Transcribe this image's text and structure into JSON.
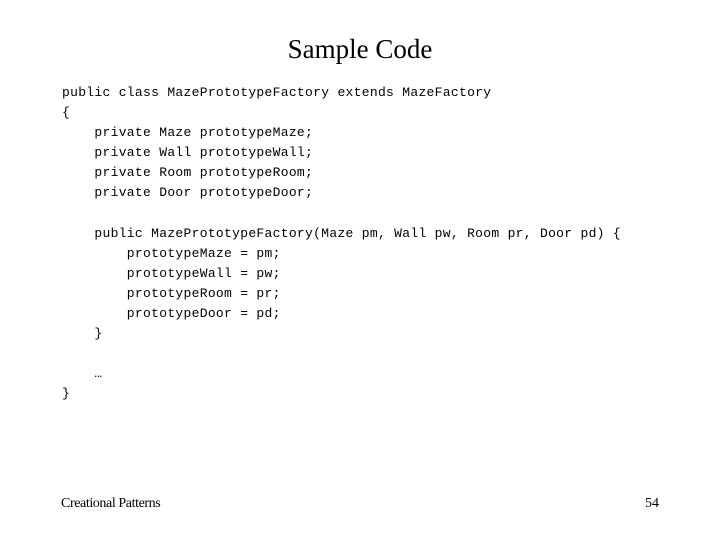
{
  "slide": {
    "title": "Sample Code",
    "code_lines": [
      "public class MazePrototypeFactory extends MazeFactory",
      "{",
      "    private Maze prototypeMaze;",
      "    private Wall prototypeWall;",
      "    private Room prototypeRoom;",
      "    private Door prototypeDoor;",
      "",
      "    public MazePrototypeFactory(Maze pm, Wall pw, Room pr, Door pd) {",
      "        prototypeMaze = pm;",
      "        prototypeWall = pw;",
      "        prototypeRoom = pr;",
      "        prototypeDoor = pd;",
      "    }",
      "",
      "    …",
      "}"
    ]
  },
  "footer": {
    "left_text": "Creational Patterns",
    "page_number": "54"
  }
}
